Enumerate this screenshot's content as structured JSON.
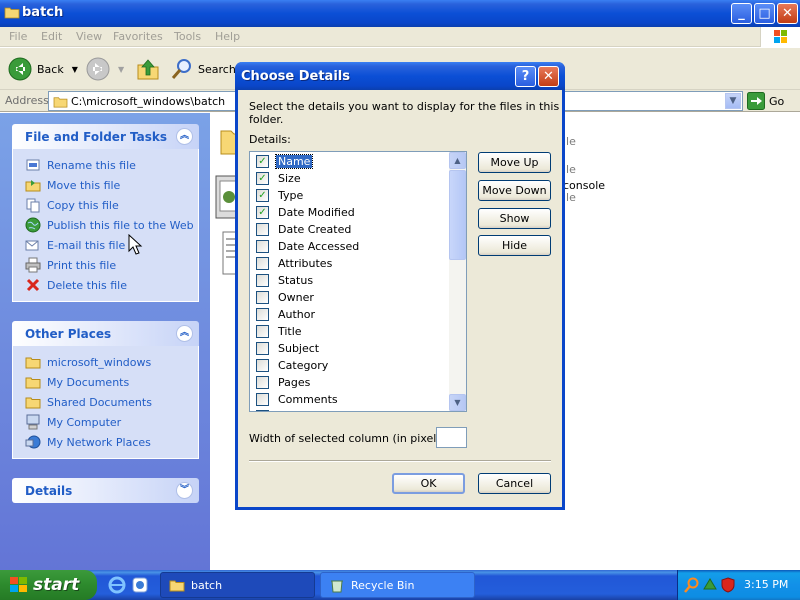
{
  "window": {
    "title": "batch",
    "buttons": {
      "minimize": "_",
      "maximize": "□",
      "close": "✕"
    }
  },
  "menu": [
    "File",
    "Edit",
    "View",
    "Favorites",
    "Tools",
    "Help"
  ],
  "toolbar": {
    "back": "Back",
    "search": "Search"
  },
  "address": {
    "label": "Address",
    "value": "C:\\microsoft_windows\\batch",
    "go": "Go"
  },
  "left": {
    "file_tasks": {
      "title": "File and Folder Tasks",
      "items": [
        {
          "label": "Rename this file",
          "icon": "rename-icon"
        },
        {
          "label": "Move this file",
          "icon": "move-icon"
        },
        {
          "label": "Copy this file",
          "icon": "copy-icon"
        },
        {
          "label": "Publish this file to the Web",
          "icon": "globe-icon"
        },
        {
          "label": "E-mail this file",
          "icon": "email-icon"
        },
        {
          "label": "Print this file",
          "icon": "printer-icon"
        },
        {
          "label": "Delete this file",
          "icon": "delete-icon"
        }
      ]
    },
    "other_places": {
      "title": "Other Places",
      "items": [
        {
          "label": "microsoft_windows",
          "icon": "folder-icon"
        },
        {
          "label": "My Documents",
          "icon": "folder-icon"
        },
        {
          "label": "Shared Documents",
          "icon": "folder-icon"
        },
        {
          "label": "My Computer",
          "icon": "computer-icon"
        },
        {
          "label": "My Network Places",
          "icon": "network-icon"
        }
      ]
    },
    "details": {
      "title": "Details"
    }
  },
  "right": {
    "partial_texts": [
      "ile",
      "ile",
      "console",
      "ile"
    ]
  },
  "dialog": {
    "title": "Choose Details",
    "instruction": "Select the details you want to display for the files in this folder.",
    "details_label": "Details:",
    "items": [
      {
        "label": "Name",
        "checked": true,
        "selected": true
      },
      {
        "label": "Size",
        "checked": true,
        "selected": false
      },
      {
        "label": "Type",
        "checked": true,
        "selected": false
      },
      {
        "label": "Date Modified",
        "checked": true,
        "selected": false
      },
      {
        "label": "Date Created",
        "checked": false,
        "selected": false
      },
      {
        "label": "Date Accessed",
        "checked": false,
        "selected": false
      },
      {
        "label": "Attributes",
        "checked": false,
        "selected": false
      },
      {
        "label": "Status",
        "checked": false,
        "selected": false
      },
      {
        "label": "Owner",
        "checked": false,
        "selected": false
      },
      {
        "label": "Author",
        "checked": false,
        "selected": false
      },
      {
        "label": "Title",
        "checked": false,
        "selected": false
      },
      {
        "label": "Subject",
        "checked": false,
        "selected": false
      },
      {
        "label": "Category",
        "checked": false,
        "selected": false
      },
      {
        "label": "Pages",
        "checked": false,
        "selected": false
      },
      {
        "label": "Comments",
        "checked": false,
        "selected": false
      }
    ],
    "buttons": {
      "move_up": "Move Up",
      "move_down": "Move Down",
      "show": "Show",
      "hide": "Hide",
      "ok": "OK",
      "cancel": "Cancel"
    },
    "width_label": "Width of selected column (in pixels):",
    "width_value": ""
  },
  "taskbar": {
    "start": "start",
    "tasks": [
      "batch",
      "Recycle Bin"
    ],
    "clock": "3:15 PM"
  },
  "colors": {
    "xp_blue": "#0a46c9",
    "task_link": "#215dc6",
    "start_green": "#2d8a2d"
  }
}
